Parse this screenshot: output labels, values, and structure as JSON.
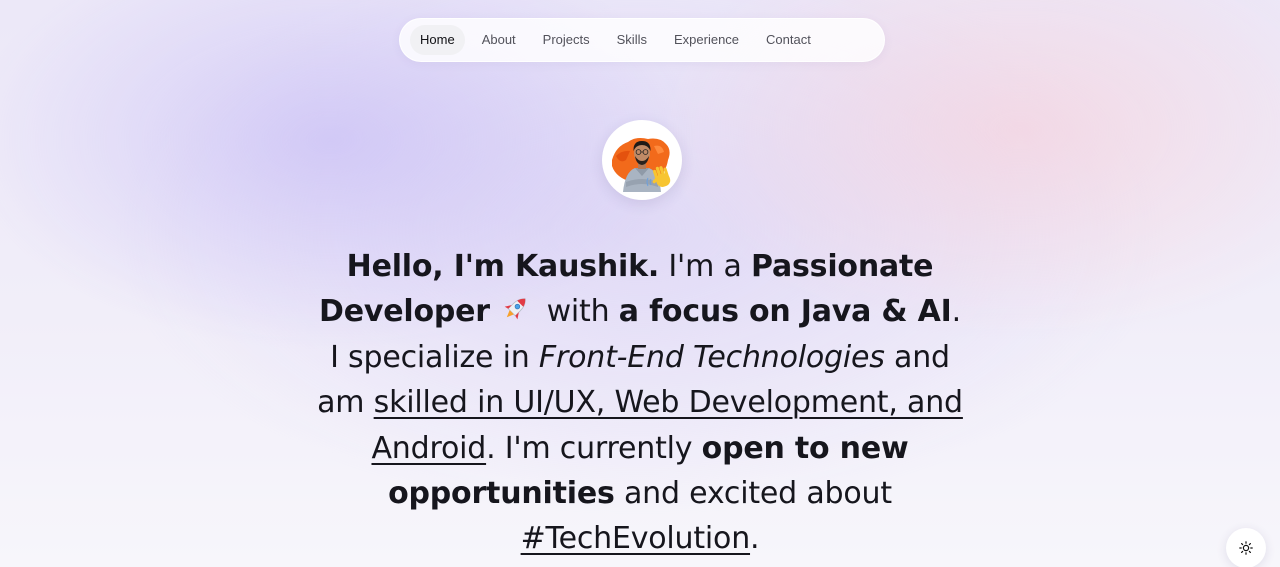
{
  "nav": {
    "items": [
      {
        "label": "Home",
        "active": true
      },
      {
        "label": "About"
      },
      {
        "label": "Projects"
      },
      {
        "label": "Skills"
      },
      {
        "label": "Experience"
      },
      {
        "label": "Contact"
      }
    ]
  },
  "avatar": {
    "icon": "profile-photo-with-waving-hand",
    "accent_color": "#f26a1b"
  },
  "intro": {
    "name_greeting": "Hello, I'm Kaushik.",
    "im_a": " I'm a ",
    "passionate_developer": "Passionate Developer",
    "rocket_icon": "rocket-icon",
    "with": " with ",
    "focus": "a focus on Java & AI",
    "i_specialize": ". I specialize in ",
    "frontend": "Front-End Technologies",
    "and_am": " and am ",
    "skilled": "skilled in UI/UX, Web Development, and Android",
    "currently": ". I'm currently ",
    "open": "open to new opportunities",
    "excited": " and excited about ",
    "hashtag": "#TechEvolution",
    "period": "."
  },
  "theme_toggle": {
    "icon": "sun-icon"
  }
}
